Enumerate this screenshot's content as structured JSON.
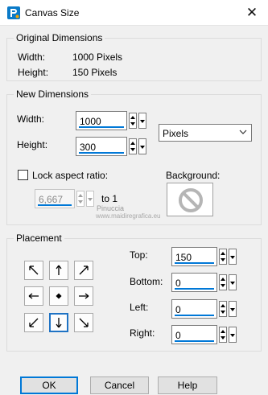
{
  "window": {
    "title": "Canvas Size",
    "close_glyph": "✕"
  },
  "original": {
    "legend": "Original Dimensions",
    "width_label": "Width:",
    "width_value": "1000 Pixels",
    "height_label": "Height:",
    "height_value": "150 Pixels"
  },
  "new_dims": {
    "legend": "New Dimensions",
    "width_label": "Width:",
    "width_value": "1000",
    "height_label": "Height:",
    "height_value": "300",
    "units_selected": "Pixels",
    "lock_label": "Lock aspect ratio:",
    "lock_checked": false,
    "ratio_value": "6,667",
    "ratio_suffix": "to 1",
    "background_label": "Background:",
    "background_icon": "no-color-icon"
  },
  "watermark": {
    "line1": "Pinuccia",
    "line2": "www.maidiregrafica.eu"
  },
  "placement": {
    "legend": "Placement",
    "anchors": [
      "arrow-up-left",
      "arrow-up",
      "arrow-up-right",
      "arrow-left",
      "center-dot",
      "arrow-right",
      "arrow-down-left",
      "arrow-down",
      "arrow-down-right"
    ],
    "selected_anchor": "arrow-down",
    "top_label": "Top:",
    "top_value": "150",
    "bottom_label": "Bottom:",
    "bottom_value": "0",
    "left_label": "Left:",
    "left_value": "0",
    "right_label": "Right:",
    "right_value": "0"
  },
  "buttons": {
    "ok": "OK",
    "cancel": "Cancel",
    "help": "Help"
  },
  "colors": {
    "accent": "#0078d7",
    "selected_border": "#1f73c4",
    "dialog_bg": "#f0f0f0",
    "no_color_icon": "#b5b5b5"
  }
}
